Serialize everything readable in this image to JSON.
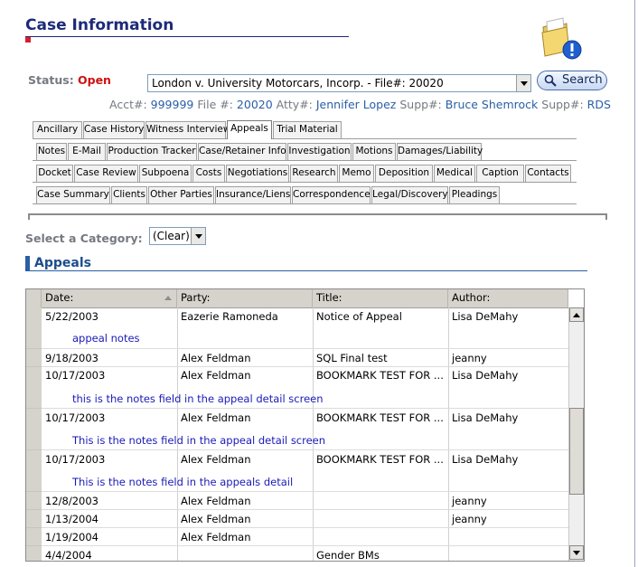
{
  "header": {
    "title": "Case Information",
    "status_label": "Status:",
    "status_value": "Open",
    "case_select_value": "London v. University Motorcars, Incorp. - File#: 20020",
    "search_label": "Search",
    "acct_label": "Acct#:",
    "acct_value": "999999",
    "file_label": "File #:",
    "file_value": "20020",
    "atty_label": "Atty#:",
    "atty_value": "Jennifer Lopez",
    "supp1_label": "Supp#:",
    "supp1_value": "Bruce Shemrock",
    "supp2_label": "Supp#:",
    "supp2_value": "RDS"
  },
  "tabs": {
    "row1": [
      "Ancillary",
      "Case History",
      "Witness Interview",
      "Appeals",
      "Trial Material"
    ],
    "row2": [
      "Notes",
      "E-Mail",
      "Production Tracker",
      "Case/Retainer Info",
      "Investigation",
      "Motions",
      "Damages/Liability"
    ],
    "row3": [
      "Docket",
      "Case Review",
      "Subpoena",
      "Costs",
      "Negotiations",
      "Research",
      "Memo",
      "Deposition",
      "Medical",
      "Caption",
      "Contacts"
    ],
    "row4": [
      "Case Summary",
      "Clients",
      "Other Parties",
      "Insurance/Liens",
      "Correspondence",
      "Legal/Discovery",
      "Pleadings"
    ],
    "active": "Appeals"
  },
  "category": {
    "label": "Select a Category:",
    "value": "(Clear)"
  },
  "section": {
    "title": "Appeals"
  },
  "grid": {
    "headers": [
      "Date:",
      "Party:",
      "Title:",
      "Author:"
    ],
    "rows": [
      {
        "date": "5/22/2003",
        "party": "Eazerie Ramoneda",
        "title": "Notice of Appeal",
        "author": "Lisa DeMahy",
        "note": "appeal notes"
      },
      {
        "date": "9/18/2003",
        "party": "Alex Feldman",
        "title": "SQL Final test",
        "author": "jeanny",
        "note": ""
      },
      {
        "date": "10/17/2003",
        "party": "Alex Feldman",
        "title": "BOOKMARK TEST FOR ...",
        "author": "Lisa DeMahy",
        "note": "this is the notes field in the appeal detail screen"
      },
      {
        "date": "10/17/2003",
        "party": "Alex Feldman",
        "title": "BOOKMARK TEST FOR ...",
        "author": "Lisa DeMahy",
        "note": "This is the notes field in the appeal detail screen"
      },
      {
        "date": "10/17/2003",
        "party": "Alex Feldman",
        "title": "BOOKMARK TEST FOR ...",
        "author": "Lisa DeMahy",
        "note": "This is the notes field in the appeals detail"
      },
      {
        "date": "12/8/2003",
        "party": "Alex Feldman",
        "title": "",
        "author": "jeanny",
        "note": ""
      },
      {
        "date": "1/13/2004",
        "party": "Alex Feldman",
        "title": "",
        "author": "jeanny",
        "note": ""
      },
      {
        "date": "1/19/2004",
        "party": "Alex Feldman",
        "title": "",
        "author": "",
        "note": ""
      },
      {
        "date": "4/4/2004",
        "party": "",
        "title": "Gender BMs",
        "author": "",
        "note": ""
      }
    ]
  },
  "colors": {
    "title": "#1d2a78",
    "status_open": "#cc1111",
    "link_value": "#2a5fa5",
    "note_text": "#1a1ab8"
  },
  "icons": [
    "folder-alert-icon",
    "magnifier-icon",
    "chevron-down-icon",
    "sort-ascending-icon",
    "scroll-up-icon",
    "scroll-down-icon"
  ]
}
